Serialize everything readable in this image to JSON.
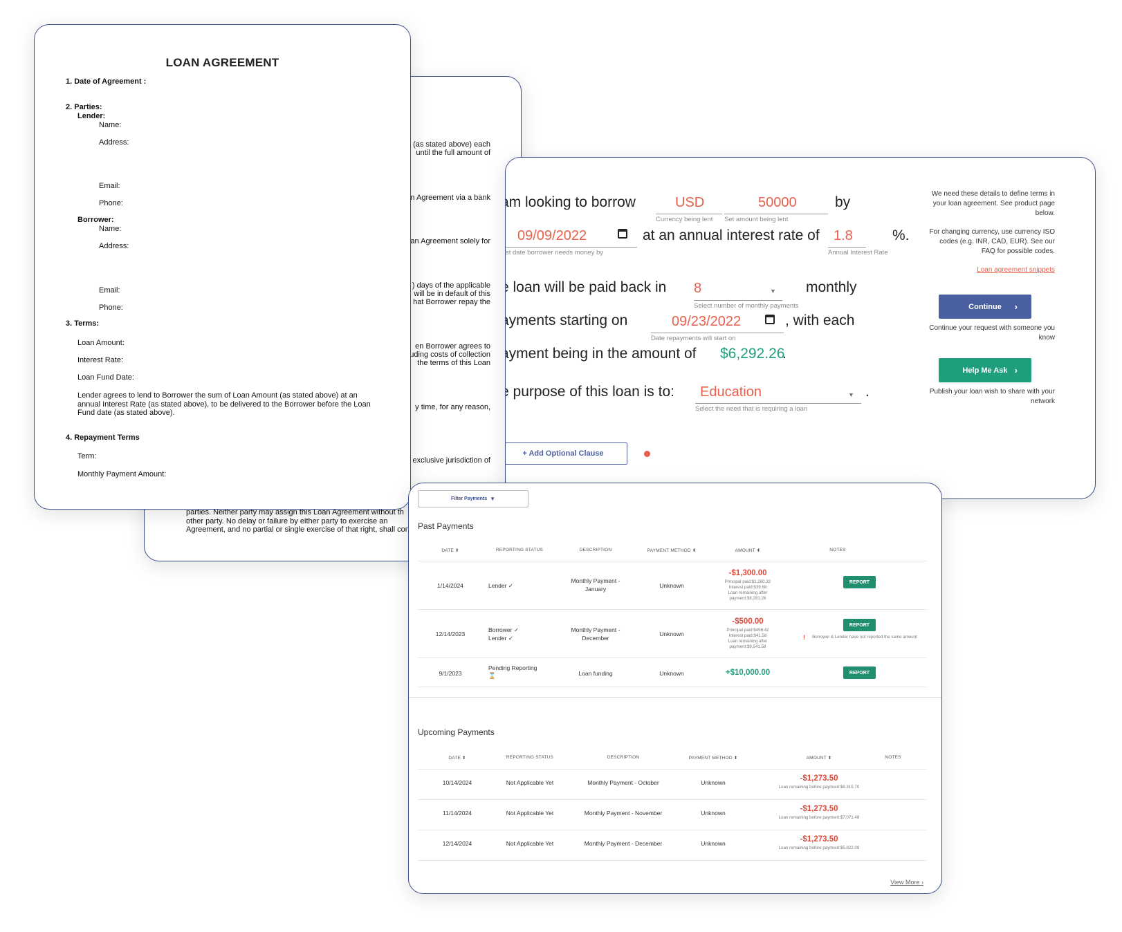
{
  "back_doc": {
    "lines": [
      "(as stated above) each",
      "until the full amount of",
      "n Agreement via a bank",
      "an Agreement solely for",
      ") days of the applicable",
      "will be in default of this",
      "hat Borrower repay the",
      "en Borrower agrees to",
      "uding costs of collection",
      "the terms of this Loan",
      "y time, for any reason,",
      "exclusive jurisdiction of"
    ],
    "bottom_fragment": "parties.  Neither party may assign this Loan Agreement without th other party.  No delay or failure by either party to exercise an Agreement, and no partial or single exercise of that right, shall cons"
  },
  "front_doc": {
    "title": "LOAN AGREEMENT",
    "s1": "1.  Date of Agreement :",
    "s2": "2.  Parties:",
    "lender": "Lender:",
    "borrower": "Borrower:",
    "name": "Name:",
    "address": "Address:",
    "email": "Email:",
    "phone": "Phone:",
    "s3": "3.  Terms:",
    "loan_amount": "Loan Amount:",
    "interest_rate": "Interest Rate:",
    "fund_date": "Loan Fund Date:",
    "terms_para": "Lender agrees to lend to Borrower the sum of Loan Amount (as stated above) at an annual Interest Rate (as stated above), to be delivered to the Borrower before the Loan Fund date (as stated above).",
    "s4": "4.  Repayment Terms",
    "term": "Term:",
    "monthly_payment": "Monthly Payment Amount:"
  },
  "loan_form": {
    "t1": "am looking to borrow",
    "currency": "USD",
    "currency_hint": "Currency being lent",
    "amount": "50000",
    "amount_hint": "Set amount being lent",
    "by": "by",
    "date": "09/09/2022",
    "date_hint": "st date borrower needs money by",
    "t2": "at an annual interest rate of",
    "rate": "1.8",
    "percent": "%.",
    "rate_hint": "Annual Interest Rate",
    "t3": "e loan will be paid back in",
    "num_payments": "8",
    "num_hint": "Select number of monthly payments",
    "monthly": "monthly",
    "t4": "ayments starting on",
    "start_date": "09/23/2022",
    "start_hint": "Date repayments will start on",
    "t5": ", with each",
    "t6": "ayment being in the amount of",
    "payment_amount": "$6,292.26",
    "period": ".",
    "t7": "e purpose of this loan is to:",
    "purpose": "Education",
    "purpose_hint": "Select the need that is requiring a loan",
    "purpose_period": ".",
    "add_clause": "+ Add Optional Clause",
    "side1": "We need these details to define terms in your loan agreement. See product page below.",
    "side2": "For changing currency, use currency ISO codes (e.g. INR, CAD, EUR). See our FAQ for possible codes.",
    "snippets_link": "Loan agreement snippets",
    "continue": "Continue",
    "continue_note": "Continue your request with someone you know",
    "help": "Help Me Ask",
    "help_note": "Publish your loan wish to share with your network",
    "accent_blue": "#4a5f9f",
    "accent_green": "#1f9e7e",
    "accent_red": "#e8604c"
  },
  "payments": {
    "filter": "Filter Payments",
    "past_title": "Past Payments",
    "past_headers": [
      "DATE ⬍",
      "REPORTING STATUS",
      "DESCRIPTION",
      "PAYMENT METHOD ⬍",
      "AMOUNT ⬍",
      "NOTES"
    ],
    "past_rows": [
      {
        "date": "1/14/2024",
        "status1": "Lender ✓",
        "status2": "",
        "desc1": "Monthly Payment -",
        "desc2": "January",
        "method": "Unknown",
        "amount": "-$1,300.00",
        "d1": "Principal paid:$1,260.32",
        "d2": "Interest paid:$39.68",
        "d3": "Loan remaining after",
        "d4": "payment:$8,281.26",
        "report": "REPORT",
        "note": ""
      },
      {
        "date": "12/14/2023",
        "status1": "Borrower ✓",
        "status2": "Lender ✓",
        "desc1": "Monthly Payment -",
        "desc2": "December",
        "method": "Unknown",
        "amount": "-$500.00",
        "d1": "Principal paid:$458.42",
        "d2": "Interest paid:$41.58",
        "d3": "Loan remaining after",
        "d4": "payment:$9,541.58",
        "report": "REPORT",
        "note": "Borrower & Lender have not reported the same amount"
      },
      {
        "date": "9/1/2023",
        "status1": "Pending Reporting",
        "status2": "⌛",
        "desc1": "Loan funding",
        "desc2": "",
        "method": "Unknown",
        "amount": "+$10,000.00",
        "d1": "",
        "d2": "",
        "d3": "",
        "d4": "",
        "report": "REPORT",
        "note": ""
      }
    ],
    "upcoming_title": "Upcoming Payments",
    "up_headers": [
      "DATE ⬍",
      "REPORTING STATUS",
      "DESCRIPTION",
      "PAYMENT METHOD ⬍",
      "AMOUNT ⬍",
      "NOTES"
    ],
    "up_rows": [
      {
        "date": "10/14/2024",
        "status": "Not Applicable Yet",
        "desc": "Monthly Payment - October",
        "method": "Unknown",
        "amount": "-$1,273.50",
        "detail": "Loan remaining before payment:$8,315.70"
      },
      {
        "date": "11/14/2024",
        "status": "Not Applicable Yet",
        "desc": "Monthly Payment - November",
        "method": "Unknown",
        "amount": "-$1,273.50",
        "detail": "Loan remaining before payment:$7,071.48"
      },
      {
        "date": "12/14/2024",
        "status": "Not Applicable Yet",
        "desc": "Monthly Payment - December",
        "method": "Unknown",
        "amount": "-$1,273.50",
        "detail": "Loan remaining before payment:$5,822.09"
      }
    ],
    "view_more": "View More"
  }
}
